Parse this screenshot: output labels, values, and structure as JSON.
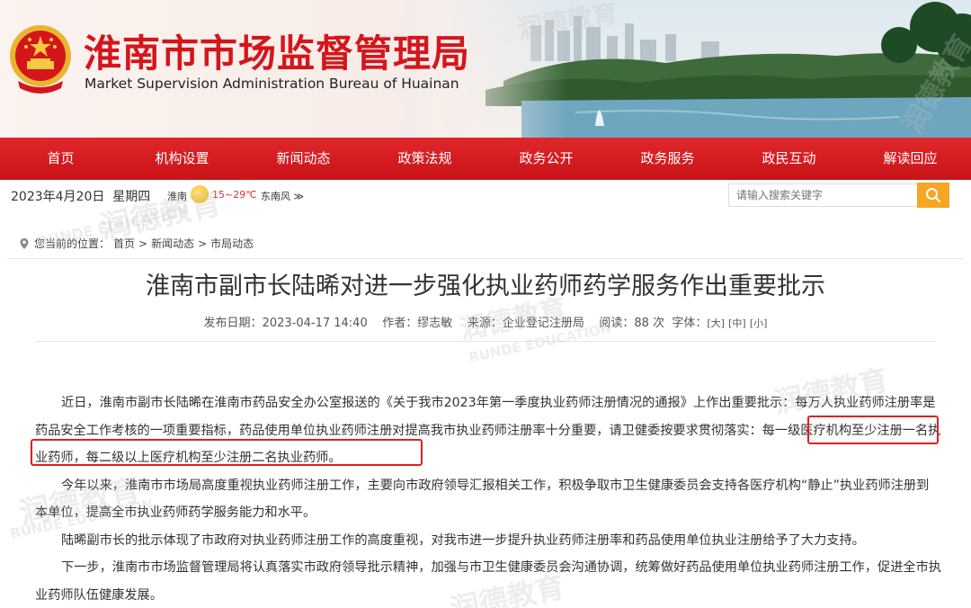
{
  "header": {
    "title": "淮南市市场监督管理局",
    "subtitle": "Market Supervision Administration Bureau of Huainan",
    "colors": {
      "brand_red": "#d4161c",
      "nav_red": "#d41d22"
    }
  },
  "nav": {
    "items": [
      "首页",
      "机构设置",
      "新闻动态",
      "政策法规",
      "政务公开",
      "政务服务",
      "政民互动",
      "解读回应"
    ]
  },
  "infobar": {
    "date": "2023年4月20日",
    "weekday": "星期四",
    "city": "淮南",
    "temperature": "15~29℃",
    "wind": "东南风",
    "wind_more": "≫",
    "weather_icon": "sun-icon"
  },
  "search": {
    "placeholder": "请输入搜索关键字",
    "icon": "search-icon"
  },
  "breadcrumb": {
    "prefix": "您当前的位置：",
    "items": [
      "首页",
      "新闻动态",
      "市局动态"
    ],
    "separator": ">"
  },
  "article": {
    "title": "淮南市副市长陆晞对进一步强化执业药师药学服务作出重要批示",
    "meta": {
      "date_label": "发布日期：",
      "date": "2023-04-17 14:40",
      "author_label": "作者：",
      "author": "缪志敏",
      "source_label": "来源：",
      "source": "企业登记注册局",
      "reads_label": "阅读：",
      "reads": "88",
      "reads_unit": "次",
      "fontsize_label": "字体：",
      "size_large": "[大]",
      "size_medium": "[中]",
      "size_small": "[小]"
    },
    "paragraphs": [
      "近日，淮南市副市长陆晞在淮南市药品安全办公室报送的《关于我市2023年第一季度执业药师注册情况的通报》上作出重要批示：每万人执业药师注册率是药品安全工作考核的一项重要指标，药品使用单位执业药师注册对提高我市执业药师注册率十分重要，请卫健委按要求贯彻落实：每一级医疗机构至少注册一名执业药师，每二级以上医疗机构至少注册二名执业药师。",
      "今年以来，淮南市市场局高度重视执业药师注册工作，主要向市政府领导汇报相关工作，积极争取市卫生健康委员会支持各医疗机构“静止”执业药师注册到本单位，提高全市执业药师药学服务能力和水平。",
      "陆晞副市长的批示体现了市政府对执业药师注册工作的高度重视，对我市进一步提升执业药师注册率和药品使用单位执业注册给予了大力支持。",
      "下一步，淮南市市场监督管理局将认真落实市政府领导批示精神，加强与市卫生健康委员会沟通协调，统筹做好药品使用单位执业药师注册工作，促进全市执业药师队伍健康发展。"
    ]
  },
  "watermarks": [
    "润德教育",
    "RUNDE EDUCATION"
  ]
}
